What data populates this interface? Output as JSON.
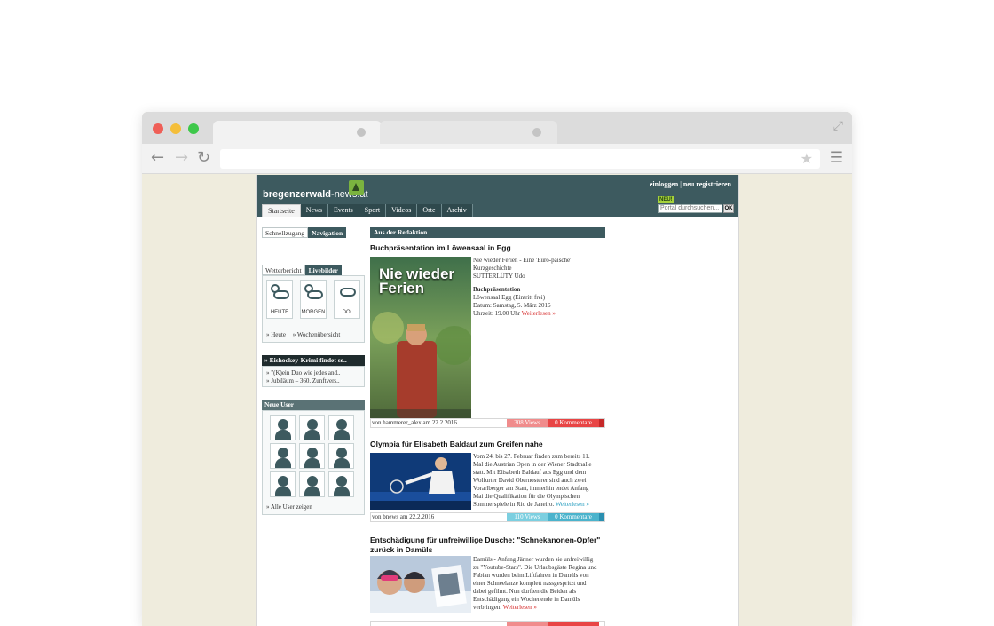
{
  "site": {
    "logo_bold": "bregenzerwald",
    "logo_rest": "-news.at",
    "login": "einloggen",
    "separator": " | ",
    "register": "neu registrieren",
    "new_badge": "NEU!",
    "search_placeholder": "Portal durchsuchen...",
    "ok": "OK"
  },
  "nav": [
    "Startseite",
    "News",
    "Events",
    "Sport",
    "Videos",
    "Orte",
    "Archiv"
  ],
  "sidebar": {
    "tabs": [
      "Schnellzugang",
      "Navigation"
    ],
    "weather_tabs": [
      "Wetterbericht",
      "Livebilder"
    ],
    "weather_days": [
      "HEUTE",
      "MORGEN",
      "DO."
    ],
    "weather_links": [
      "» Heute",
      "» Wochenübersicht"
    ],
    "news_title": "» Eishockey-Krimi findet se..",
    "news_items": [
      "» \"(K)ein Duo wie jedes and..",
      "» Jubiläum – 360. Zunftvers.."
    ],
    "users_title": "Neue User",
    "users_link": "» Alle User zeigen"
  },
  "main": {
    "section_title": "Aus der Redaktion",
    "articles": [
      {
        "title": "Buchpräsentation im Löwensaal in Egg",
        "lines": [
          "Nie wieder Ferien - Eine 'Euro-päische'",
          "Kurzgeschichte",
          "SUTTERLÜTY Udo"
        ],
        "sub_title": "Buchpräsentation",
        "sub_lines": [
          "Löwensaal Egg (Eintritt frei)",
          "Datum: Samstag, 5. März 2016"
        ],
        "last_line": "Uhrzeit: 19.00 Uhr ",
        "more": "Weiterlesen »",
        "cover_title": "Nie wieder Ferien",
        "byline": "von hammerer_alex am 22.2.2016",
        "views": "308 Views",
        "comments": "0 Kommentare"
      },
      {
        "title": "Olympia für Elisabeth Baldauf zum Greifen nahe",
        "lines": [
          "Vom 24. bis 27. Februar finden zum bereits 11.",
          "Mal die Austrian Open in der Wiener Stadthalle",
          "statt. Mit Elisabeth Baldauf aus Egg und dem",
          "Wolfurter David Obernosterer sind auch zwei",
          "Vorarlberger am Start, immerhin endet Anfang",
          "Mai die Qualifikation für die Olympischen"
        ],
        "last_line": "Sommerspiele in Rio de Janeiro. ",
        "more": "Weiterlesen »",
        "byline": "von bnews am 22.2.2016",
        "views": "110 Views",
        "comments": "0 Kommentare"
      },
      {
        "title_line1": "Entschädigung für unfreiwillige Dusche: \"Schnekanonen-Opfer\"",
        "title_line2": "zurück in Damüls",
        "lines": [
          "Damüls - Anfang Jänner wurden sie unfreiwillig",
          "zu \"Youtube-Stars\". Die Urlaubsgäste Regina und",
          "Fabian wurden beim Liftfahren in Damüls von",
          "einer Schneelanze komplett nassgespritzt und",
          "dabei gefilmt. Nun durften die Beiden als",
          "Entschädigung ein Wochenende in Damüls"
        ],
        "last_line": "verbringen. ",
        "more": "Weiterlesen »"
      }
    ]
  },
  "colors": {
    "header": "#3d5a5f",
    "red_views": "#f08c8c",
    "red_comments": "#e84545",
    "blue_views": "#7ccfe0",
    "blue_comments": "#4bb3cc"
  }
}
